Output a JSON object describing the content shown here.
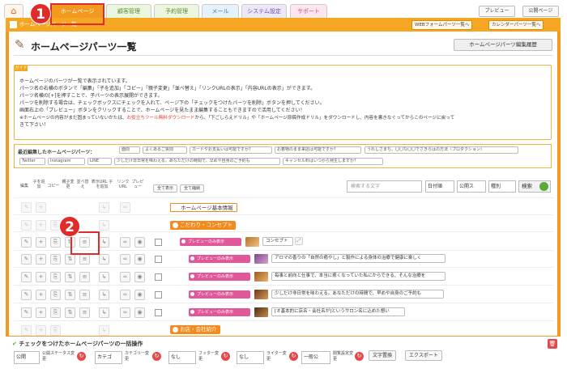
{
  "top_tabs": {
    "home_icon": "home-icon",
    "homepage": "ホームページ",
    "customer": "顧客管理",
    "reservation": "予約管理",
    "mail": "メール",
    "system": "システム設定",
    "support": "サポート"
  },
  "top_buttons": {
    "preview": "プレビュー",
    "public_page": "公開ページ"
  },
  "breadcrumb": "ホームページパーツ一覧",
  "frame_buttons": {
    "web_form": "WEBフォームパーツ一覧へ",
    "calendar": "カレンダーパーツ一覧へ"
  },
  "page": {
    "title": "ホームページパーツ一覧",
    "edit_history": "ホームページパーツ編集履歴"
  },
  "guide": {
    "label": "ガイド",
    "lines": [
      "ホームページのパーツが一覧で表示されています。",
      "パーツ名の右横のボタンで「編集」「子を追加」「コピー」「親子変更」「並べ替え」「リンクURLの表示」「内容URLの表示」ができます。",
      "パーツ名横の[+]を押すことで、子パーツの表示展開ができます。",
      "パーツを削除する場合は、チェックボックスにチェックを入れて、ページ下の「チェックをつけたパーツを削除」ボタンを押してください。",
      "画面右上の「プレビュー」ボタンをクリックすることで、ホームページを見たまま編集することもできますので活用してください！"
    ],
    "note_pre": "※ホームページの内容がまだ固まっていないかたは、",
    "note_red": "お役立ちツール無料ダウンロード",
    "note_post": "から、「下ごしらえドリル」や「ホームページ原稿作成ドリル」をダウンロードし、内容を書きなぐってからこのページに戻って",
    "note_end": "きて下さい！"
  },
  "recent": {
    "title": "最近編集したホームページパーツ：",
    "chips": [
      "Twitter",
      "Instagram",
      "LINE",
      "少しだけ非日常を味わえる。あなただけの時間で、早めや自身のご予約も",
      "キャンセル料はいつから発生しますか？"
    ],
    "chips_row1": [
      "面問",
      "よくあるご質問",
      "カードやお支払いは可能ですか？",
      "お着物のまま来店は可能ですか？",
      "うれしさまち、〇〇な〇〇でさきらはの方法（プロダクション）"
    ]
  },
  "columns": [
    "編集",
    "子を追加",
    "コピー",
    "親子変更",
    "並べ替え",
    "表示URL 子を追加",
    "リンクURL",
    "プレビュー"
  ],
  "controls": {
    "show_all": "全て表示",
    "collapse_all": "全て縮納",
    "search_placeholder": "検索する文字",
    "date_sort": "日付順",
    "public_filter": "公開ス",
    "category": "種別",
    "search_button": "検索"
  },
  "rows": {
    "basic_info": "ホームページ基本情報",
    "section1": "こだわり・コンセプト",
    "preview_badge": "プレビューのみ表示",
    "concept": "コンセプト",
    "r1": "アロマの香りの「自然の癒やし」と製作による身体の治療で健康に楽しく",
    "r2": "毎事と前向と仕事で、本当に癒くなっていた私にからできる、そんな治療を",
    "r3": "少しだけ非日常を味わえる。あなただけの時間で、早めや自身のご予約も",
    "r4": "[オ基本的に店名・会社名が]というサロン名に込めた想い",
    "section2": "お店・会社紹介"
  },
  "bottom": {
    "title": "チェックをつけたホームページパーツの一括操作",
    "public_sel": "公開",
    "public_label": "公開ステータス変更",
    "category_sel": "カテゴ",
    "category_label": "カテゴリー変更",
    "footer_sel": "なし",
    "footer_label": "フッター変更",
    "writer_sel": "なし",
    "writer_label": "ライター変更",
    "setting_sel": "一般公",
    "setting_label": "閲覧設定変更",
    "text_replace": "文字置換",
    "export": "エクスポート"
  },
  "annotations": {
    "one": "1",
    "two": "2"
  },
  "colors": {
    "accent": "#f29a1f",
    "pink": "#e0579a",
    "annotation": "#e02b2b"
  }
}
